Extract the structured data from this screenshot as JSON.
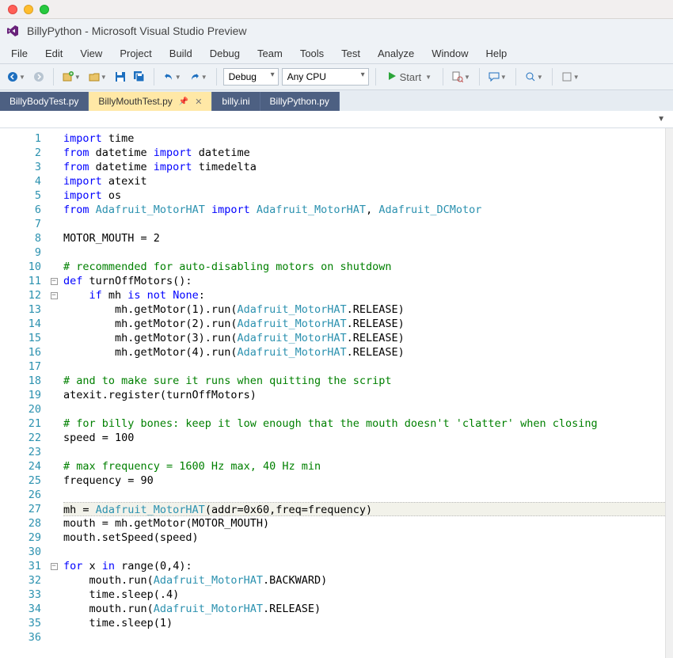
{
  "window": {
    "title": "BillyPython - Microsoft Visual Studio Preview"
  },
  "menu": [
    "File",
    "Edit",
    "View",
    "Project",
    "Build",
    "Debug",
    "Team",
    "Tools",
    "Test",
    "Analyze",
    "Window",
    "Help"
  ],
  "toolbar": {
    "config": "Debug",
    "platform": "Any CPU",
    "start_label": "Start"
  },
  "tabs": [
    {
      "label": "BillyBodyTest.py",
      "active": false
    },
    {
      "label": "BillyMouthTest.py",
      "active": true
    },
    {
      "label": "billy.ini",
      "active": false
    },
    {
      "label": "BillyPython.py",
      "active": false
    }
  ],
  "code": {
    "lines": [
      {
        "n": 1,
        "seg": [
          [
            "kw",
            "import"
          ],
          [
            "",
            " time"
          ]
        ]
      },
      {
        "n": 2,
        "seg": [
          [
            "kw",
            "from"
          ],
          [
            "",
            " datetime "
          ],
          [
            "kw",
            "import"
          ],
          [
            "",
            " datetime"
          ]
        ]
      },
      {
        "n": 3,
        "seg": [
          [
            "kw",
            "from"
          ],
          [
            "",
            " datetime "
          ],
          [
            "kw",
            "import"
          ],
          [
            "",
            " timedelta"
          ]
        ]
      },
      {
        "n": 4,
        "seg": [
          [
            "kw",
            "import"
          ],
          [
            "",
            " atexit"
          ]
        ]
      },
      {
        "n": 5,
        "seg": [
          [
            "kw",
            "import"
          ],
          [
            "",
            " os"
          ]
        ]
      },
      {
        "n": 6,
        "seg": [
          [
            "kw",
            "from"
          ],
          [
            "",
            " "
          ],
          [
            "cls",
            "Adafruit_MotorHAT"
          ],
          [
            "",
            " "
          ],
          [
            "kw",
            "import"
          ],
          [
            "",
            " "
          ],
          [
            "cls",
            "Adafruit_MotorHAT"
          ],
          [
            "",
            ", "
          ],
          [
            "cls",
            "Adafruit_DCMotor"
          ]
        ]
      },
      {
        "n": 7,
        "seg": [
          [
            "",
            ""
          ]
        ]
      },
      {
        "n": 8,
        "seg": [
          [
            "",
            "MOTOR_MOUTH = 2"
          ]
        ]
      },
      {
        "n": 9,
        "seg": [
          [
            "",
            ""
          ]
        ]
      },
      {
        "n": 10,
        "seg": [
          [
            "com",
            "# recommended for auto-disabling motors on shutdown"
          ]
        ]
      },
      {
        "n": 11,
        "fold": "-",
        "seg": [
          [
            "kw",
            "def"
          ],
          [
            "",
            " turnOffMotors():"
          ]
        ]
      },
      {
        "n": 12,
        "fold": "-",
        "seg": [
          [
            "",
            "    "
          ],
          [
            "kw",
            "if"
          ],
          [
            "",
            " mh "
          ],
          [
            "kw",
            "is not"
          ],
          [
            "",
            " "
          ],
          [
            "kw",
            "None"
          ],
          [
            "",
            ":"
          ]
        ]
      },
      {
        "n": 13,
        "seg": [
          [
            "",
            "        mh.getMotor(1).run("
          ],
          [
            "cls",
            "Adafruit_MotorHAT"
          ],
          [
            "",
            ".RELEASE)"
          ]
        ]
      },
      {
        "n": 14,
        "seg": [
          [
            "",
            "        mh.getMotor(2).run("
          ],
          [
            "cls",
            "Adafruit_MotorHAT"
          ],
          [
            "",
            ".RELEASE)"
          ]
        ]
      },
      {
        "n": 15,
        "seg": [
          [
            "",
            "        mh.getMotor(3).run("
          ],
          [
            "cls",
            "Adafruit_MotorHAT"
          ],
          [
            "",
            ".RELEASE)"
          ]
        ]
      },
      {
        "n": 16,
        "seg": [
          [
            "",
            "        mh.getMotor(4).run("
          ],
          [
            "cls",
            "Adafruit_MotorHAT"
          ],
          [
            "",
            ".RELEASE)"
          ]
        ]
      },
      {
        "n": 17,
        "seg": [
          [
            "",
            ""
          ]
        ]
      },
      {
        "n": 18,
        "seg": [
          [
            "com",
            "# and to make sure it runs when quitting the script"
          ]
        ]
      },
      {
        "n": 19,
        "seg": [
          [
            "",
            "atexit.register(turnOffMotors)"
          ]
        ]
      },
      {
        "n": 20,
        "seg": [
          [
            "",
            ""
          ]
        ]
      },
      {
        "n": 21,
        "seg": [
          [
            "com",
            "# for billy bones: keep it low enough that the mouth doesn't 'clatter' when closing"
          ]
        ]
      },
      {
        "n": 22,
        "seg": [
          [
            "",
            "speed = 100"
          ]
        ]
      },
      {
        "n": 23,
        "seg": [
          [
            "",
            ""
          ]
        ]
      },
      {
        "n": 24,
        "seg": [
          [
            "com",
            "# max frequency = 1600 Hz max, 40 Hz min"
          ]
        ]
      },
      {
        "n": 25,
        "seg": [
          [
            "",
            "frequency = 90"
          ]
        ]
      },
      {
        "n": 26,
        "seg": [
          [
            "",
            ""
          ]
        ]
      },
      {
        "n": 27,
        "hl": true,
        "seg": [
          [
            "",
            "mh = "
          ],
          [
            "cls",
            "Adafruit_MotorHAT"
          ],
          [
            "",
            "(addr=0x60,freq=frequency)"
          ]
        ]
      },
      {
        "n": 28,
        "seg": [
          [
            "",
            "mouth = mh.getMotor(MOTOR_MOUTH)"
          ]
        ]
      },
      {
        "n": 29,
        "seg": [
          [
            "",
            "mouth.setSpeed(speed)"
          ]
        ]
      },
      {
        "n": 30,
        "seg": [
          [
            "",
            ""
          ]
        ]
      },
      {
        "n": 31,
        "fold": "-",
        "seg": [
          [
            "kw",
            "for"
          ],
          [
            "",
            " x "
          ],
          [
            "kw",
            "in"
          ],
          [
            "",
            " range(0,4):"
          ]
        ]
      },
      {
        "n": 32,
        "seg": [
          [
            "",
            "    mouth.run("
          ],
          [
            "cls",
            "Adafruit_MotorHAT"
          ],
          [
            "",
            ".BACKWARD)"
          ]
        ]
      },
      {
        "n": 33,
        "seg": [
          [
            "",
            "    time.sleep(.4)"
          ]
        ]
      },
      {
        "n": 34,
        "seg": [
          [
            "",
            "    mouth.run("
          ],
          [
            "cls",
            "Adafruit_MotorHAT"
          ],
          [
            "",
            ".RELEASE)"
          ]
        ]
      },
      {
        "n": 35,
        "seg": [
          [
            "",
            "    time.sleep(1)"
          ]
        ]
      },
      {
        "n": 36,
        "seg": [
          [
            "",
            ""
          ]
        ]
      }
    ]
  }
}
